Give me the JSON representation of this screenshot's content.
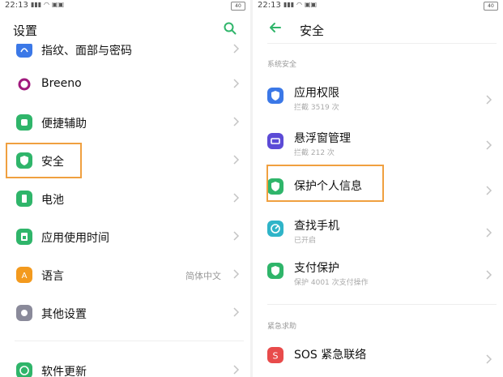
{
  "left": {
    "status": {
      "time": "22:13"
    },
    "title": "设置",
    "items": [
      {
        "label": "指纹、面部与密码",
        "icon": "fingerprint-icon",
        "color": "#3b78e7"
      },
      {
        "label": "Breeno",
        "icon": "breeno-icon",
        "color": "#a0197d"
      },
      {
        "label": "便捷辅助",
        "icon": "assist-icon",
        "color": "#2fb56a"
      },
      {
        "label": "安全",
        "icon": "shield-icon",
        "color": "#2fb56a",
        "highlighted": true
      },
      {
        "label": "电池",
        "icon": "battery-icon",
        "color": "#2fb56a"
      },
      {
        "label": "应用使用时间",
        "icon": "timer-icon",
        "color": "#2fb56a"
      },
      {
        "label": "语言",
        "icon": "language-icon",
        "color": "#f39a1e",
        "value": "简体中文"
      },
      {
        "label": "其他设置",
        "icon": "other-settings-icon",
        "color": "#8a8a9a"
      },
      {
        "label": "软件更新",
        "icon": "update-icon",
        "color": "#2fb56a"
      }
    ]
  },
  "right": {
    "status": {
      "time": "22:13"
    },
    "title": "安全",
    "section_system": "系统安全",
    "section_emergency": "紧急求助",
    "items": [
      {
        "label": "应用权限",
        "sub": "拦截 3519 次",
        "icon": "app-permission-icon",
        "color": "#3b78e7"
      },
      {
        "label": "悬浮窗管理",
        "sub": "拦截 212 次",
        "icon": "floating-window-icon",
        "color": "#5c4bd6"
      },
      {
        "label": "保护个人信息",
        "sub": "",
        "icon": "privacy-shield-icon",
        "color": "#2fb56a",
        "highlighted": true
      },
      {
        "label": "查找手机",
        "sub": "已开启",
        "icon": "find-phone-icon",
        "color": "#2fb4c8"
      },
      {
        "label": "支付保护",
        "sub": "保护 4001 次支付操作",
        "icon": "payment-protect-icon",
        "color": "#2fb56a"
      },
      {
        "label": "SOS 紧急联络",
        "sub": "",
        "icon": "sos-icon",
        "color": "#e84b4b"
      }
    ]
  },
  "colors": {
    "accent": "#2fb56a",
    "highlight": "#f0a040"
  }
}
